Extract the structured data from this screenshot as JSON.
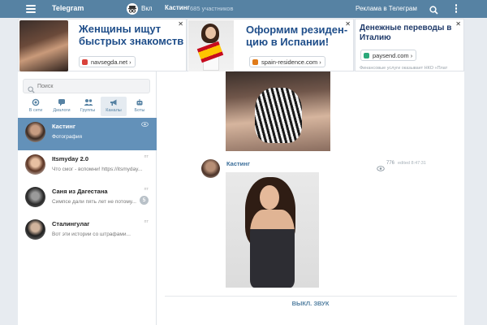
{
  "topbar": {
    "brand": "Telegram",
    "incognito_label": "Вкл",
    "channel_name": "Кастинг",
    "members": "685 участников",
    "ads_link": "Реклама в Телеграм"
  },
  "ads": [
    {
      "headline": "Женщины ищут быстрых знакомств",
      "link": "navsegda.net",
      "link_icon_color": "#d9423b",
      "close": "✕"
    },
    {
      "headline": "Оформим резиден-цию в Испании!",
      "link": "spain-residence.com",
      "link_icon_color": "#e07b1a",
      "close": "✕"
    },
    {
      "headline": "Денежные переводы в Италию",
      "link": "paysend.com",
      "link_icon_color": "#2aa87a",
      "note": "Финансовые услуги оказывает НКО «Плат",
      "close": "✕"
    }
  ],
  "sidebar": {
    "search_placeholder": "Поиск",
    "tabs": [
      {
        "label": "В сети",
        "icon": "online-icon"
      },
      {
        "label": "Диалоги",
        "icon": "chat-bubble-icon"
      },
      {
        "label": "Группы",
        "icon": "group-icon"
      },
      {
        "label": "Каналы",
        "icon": "megaphone-icon",
        "active": true
      },
      {
        "label": "Боты",
        "icon": "bot-icon"
      }
    ],
    "dialogs": [
      {
        "name": "Кастинг",
        "preview": "Фотография",
        "time": "",
        "active": true
      },
      {
        "name": "Itsmyday 2.0",
        "preview": "Что смог - вспомни! https://itsmyday...",
        "time": "пт"
      },
      {
        "name": "Саня из Дагестана",
        "preview": "Симпсе дали пять лет не потому...",
        "time": "пт",
        "badge": "5"
      },
      {
        "name": "Сталингулаг",
        "preview": "Вот эти истории со штрафами...",
        "time": "пт"
      }
    ]
  },
  "message": {
    "author": "Кастинг",
    "views": "776",
    "edited": "edited 8:47:31"
  },
  "footer": {
    "mute_button": "ВЫКЛ. ЗВУК"
  },
  "colors": {
    "header": "#5682a3",
    "active_dialog": "#6391b9",
    "accent": "#5682a3"
  }
}
